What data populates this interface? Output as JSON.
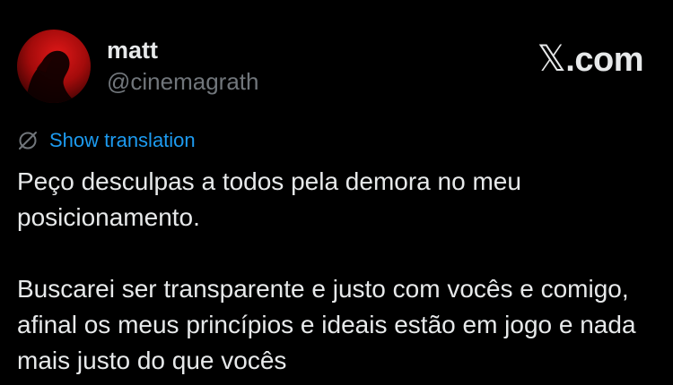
{
  "author": {
    "display_name": "matt",
    "handle": "@cinemagrath",
    "avatar_icon": "profile-avatar"
  },
  "brand": {
    "text": ".com",
    "x_glyph": "𝕏",
    "icon": "x-logo-icon"
  },
  "translation": {
    "label": "Show translation",
    "icon": "globe-slash-icon",
    "color": "#1d9bf0"
  },
  "tweet": {
    "paragraph_1": "Peço desculpas a todos pela demora no meu posicionamento.",
    "paragraph_2": "Buscarei ser transparente e justo com vocês e comigo, afinal os meus princípios e ideais estão em jogo e nada mais justo do que vocês"
  },
  "colors": {
    "background": "#000000",
    "text_primary": "#e7e9ea",
    "text_secondary": "#71767b",
    "accent": "#1d9bf0"
  }
}
